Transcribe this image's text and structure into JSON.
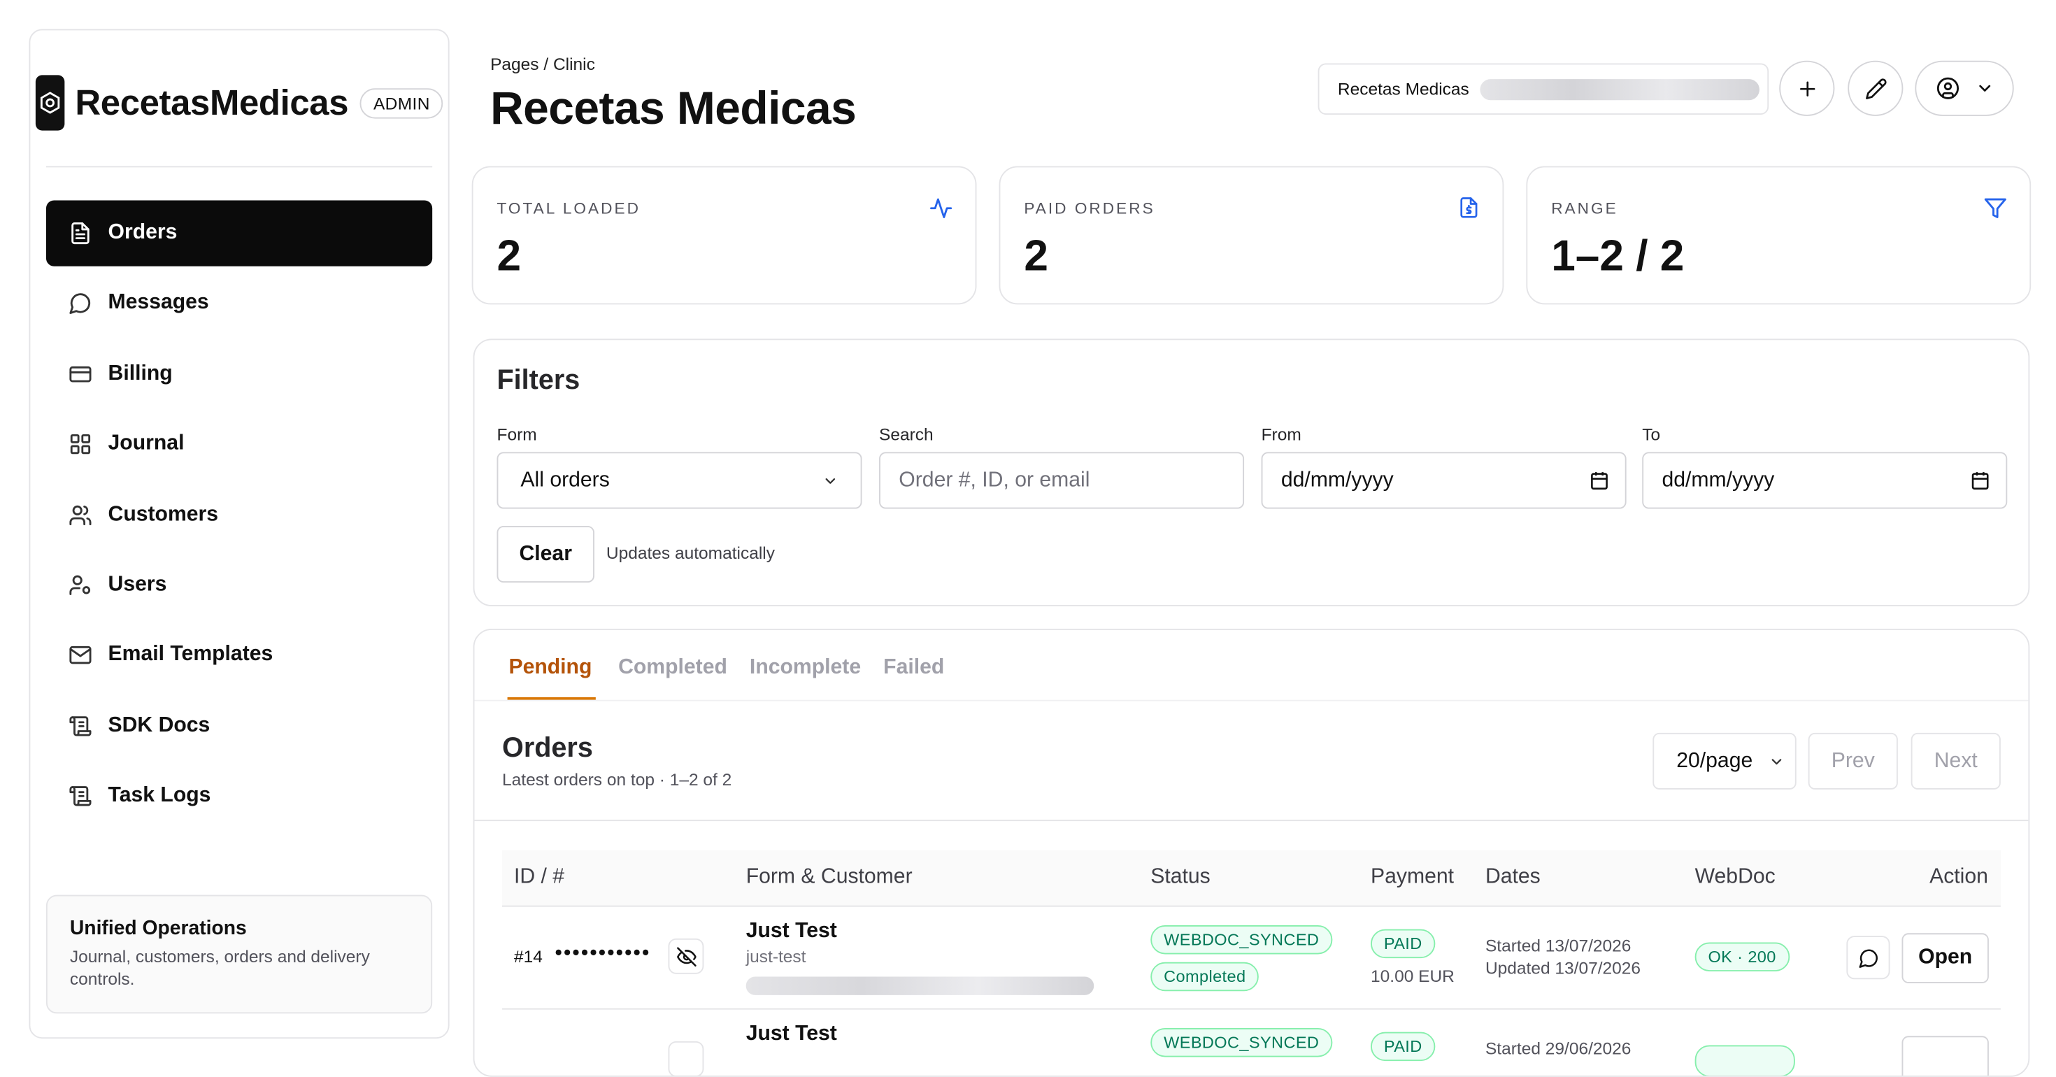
{
  "brand": {
    "name": "RecetasMedicas",
    "badge": "ADMIN"
  },
  "sidebar": {
    "items": [
      {
        "label": "Orders",
        "icon": "file-text-icon",
        "active": true
      },
      {
        "label": "Messages",
        "icon": "message-circle-icon"
      },
      {
        "label": "Billing",
        "icon": "credit-card-icon"
      },
      {
        "label": "Journal",
        "icon": "layout-grid-icon"
      },
      {
        "label": "Customers",
        "icon": "users-icon"
      },
      {
        "label": "Users",
        "icon": "user-cog-icon"
      },
      {
        "label": "Email Templates",
        "icon": "mail-icon"
      },
      {
        "label": "SDK Docs",
        "icon": "scroll-text-icon"
      },
      {
        "label": "Task Logs",
        "icon": "scroll-text-icon"
      }
    ],
    "footer": {
      "title": "Unified Operations",
      "description": "Journal, customers, orders and delivery controls."
    }
  },
  "header": {
    "breadcrumb": "Pages / Clinic",
    "title": "Recetas Medicas",
    "context_name": "Recetas Medicas"
  },
  "stats": [
    {
      "label": "TOTAL LOADED",
      "value": "2",
      "icon": "activity-icon"
    },
    {
      "label": "PAID ORDERS",
      "value": "2",
      "icon": "file-dollar-icon"
    },
    {
      "label": "RANGE",
      "value": "1–2 / 2",
      "icon": "filter-icon"
    }
  ],
  "filters": {
    "title": "Filters",
    "form_label": "Form",
    "form_value": "All orders",
    "search_label": "Search",
    "search_placeholder": "Order #, ID, or email",
    "from_label": "From",
    "from_placeholder": "dd/mm/yyyy",
    "to_label": "To",
    "to_placeholder": "dd/mm/yyyy",
    "clear_label": "Clear",
    "auto_note": "Updates automatically"
  },
  "orders": {
    "tabs": [
      "Pending",
      "Completed",
      "Incomplete",
      "Failed"
    ],
    "active_tab": "Pending",
    "title": "Orders",
    "subtitle": "Latest orders on top · 1–2 of 2",
    "page_size": "20/page",
    "prev_label": "Prev",
    "next_label": "Next",
    "columns": [
      "ID / #",
      "Form & Customer",
      "Status",
      "Payment",
      "Dates",
      "WebDoc",
      "Action"
    ],
    "rows": [
      {
        "number": "#14",
        "masked_id": "•••••••••••",
        "form": "Just Test",
        "slug": "just-test",
        "status": [
          "WEBDOC_SYNCED",
          "Completed"
        ],
        "payment_status": "PAID",
        "amount": "10.00 EUR",
        "started": "Started 13/07/2026",
        "updated": "Updated 13/07/2026",
        "webdoc": "OK · 200",
        "action": "Open"
      },
      {
        "number": "",
        "masked_id": "",
        "form": "Just Test",
        "slug": "",
        "status": [
          "WEBDOC_SYNCED"
        ],
        "payment_status": "PAID",
        "amount": "",
        "started": "Started 29/06/2026",
        "updated": "",
        "webdoc": "",
        "action": ""
      }
    ]
  },
  "colors": {
    "accent": "#d97706",
    "success": "#047857",
    "primary": "#0b0b0b",
    "icon_blue": "#2563eb"
  }
}
